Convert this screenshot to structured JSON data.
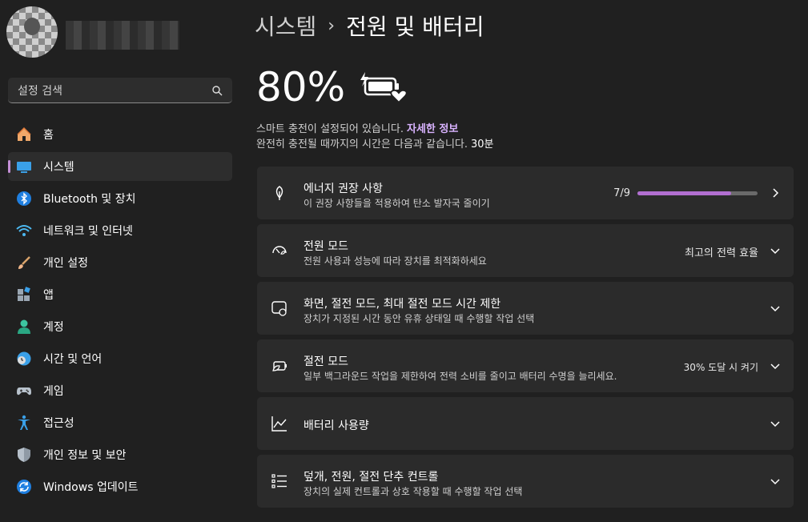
{
  "sidebar": {
    "search_placeholder": "설정 검색",
    "items": [
      {
        "label": "홈",
        "icon": "home-icon"
      },
      {
        "label": "시스템",
        "icon": "system-icon",
        "active": true
      },
      {
        "label": "Bluetooth 및 장치",
        "icon": "bluetooth-icon"
      },
      {
        "label": "네트워크 및 인터넷",
        "icon": "wifi-icon"
      },
      {
        "label": "개인 설정",
        "icon": "brush-icon"
      },
      {
        "label": "앱",
        "icon": "apps-icon"
      },
      {
        "label": "계정",
        "icon": "account-icon"
      },
      {
        "label": "시간 및 언어",
        "icon": "time-language-icon"
      },
      {
        "label": "게임",
        "icon": "gamepad-icon"
      },
      {
        "label": "접근성",
        "icon": "accessibility-icon"
      },
      {
        "label": "개인 정보 및 보안",
        "icon": "shield-icon"
      },
      {
        "label": "Windows 업데이트",
        "icon": "update-icon"
      }
    ]
  },
  "header": {
    "breadcrumb_parent": "시스템",
    "breadcrumb_separator": "›",
    "page_title": "전원 및 배터리"
  },
  "battery": {
    "percent": "80%",
    "smart_charging_text": "스마트 충전이 설정되어 있습니다.",
    "details_link": "자세한 정보",
    "time_to_full_text": "완전히 충전될 때까지의 시간은 다음과 같습니다.",
    "time_to_full_value": "30분"
  },
  "cards": [
    {
      "title": "에너지 권장 사항",
      "subtitle": "이 권장 사항들을 적용하여 탄소 발자국 줄이기",
      "right": "7/9",
      "progress": 0.78,
      "chevron": "chevron-right-icon",
      "icon": "leaf-icon"
    },
    {
      "title": "전원 모드",
      "subtitle": "전원 사용과 성능에 따라 장치를 최적화하세요",
      "right": "최고의 전력 효율",
      "chevron": "chevron-down-icon",
      "icon": "power-mode-icon"
    },
    {
      "title": "화면, 절전 모드, 최대 절전 모드 시간 제한",
      "subtitle": "장치가 지정된 시간 동안 유휴 상태일 때 수행할 작업 선택",
      "right": "",
      "chevron": "chevron-down-icon",
      "icon": "screen-sleep-icon"
    },
    {
      "title": "절전 모드",
      "subtitle": "일부 백그라운드 작업을 제한하여 전력 소비를 줄이고 배터리 수명을 늘리세요.",
      "right": "30% 도달 시 켜기",
      "chevron": "chevron-down-icon",
      "icon": "battery-saver-icon"
    },
    {
      "title": "배터리 사용량",
      "subtitle": "",
      "right": "",
      "chevron": "chevron-down-icon",
      "icon": "chart-icon"
    },
    {
      "title": "덮개, 전원, 절전 단추 컨트롤",
      "subtitle": "장치의 실제 컨트롤과 상호 작용할 때 수행할 작업 선택",
      "right": "",
      "chevron": "chevron-down-icon",
      "icon": "list-icon"
    }
  ],
  "colors": {
    "accent": "#b26fd1",
    "link": "#d9b3ff",
    "background": "#202020",
    "card": "#2b2b2b"
  }
}
